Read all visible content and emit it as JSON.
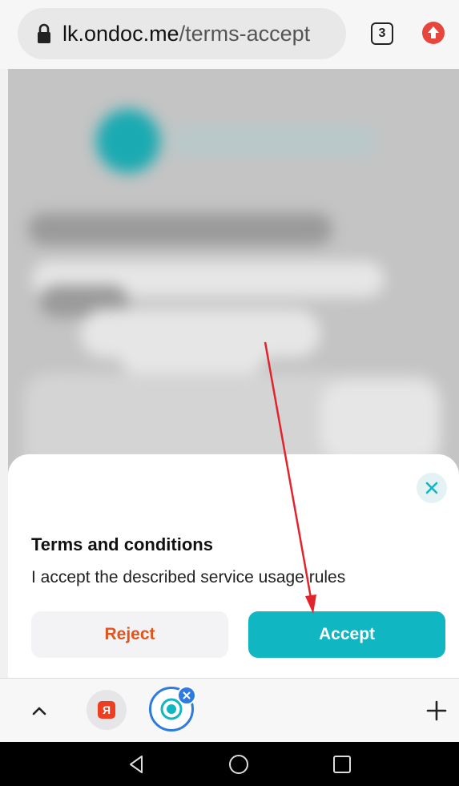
{
  "browser": {
    "url_host": "lk.ondoc.me",
    "url_path": "/terms-accept",
    "tab_count": "3",
    "icons": {
      "lock": "lock-icon",
      "update": "update-available-icon"
    }
  },
  "dialog": {
    "title": "Terms and conditions",
    "text": "I accept the described service usage rules",
    "reject_label": "Reject",
    "accept_label": "Accept",
    "close_icon": "close-icon"
  },
  "bottom_toolbar": {
    "yandex_tab_label": "Я",
    "icons": [
      "chevron-up-icon",
      "yandex-tab-icon",
      "active-tab-icon",
      "tab-close-icon",
      "plus-icon"
    ]
  },
  "system_nav": {
    "icons": [
      "back-icon",
      "home-icon",
      "recents-icon"
    ]
  },
  "colors": {
    "accent": "#10b6c2",
    "reject_text": "#e2541d",
    "annotation_arrow": "#e3232b",
    "tab_highlight": "#2d7be0"
  }
}
